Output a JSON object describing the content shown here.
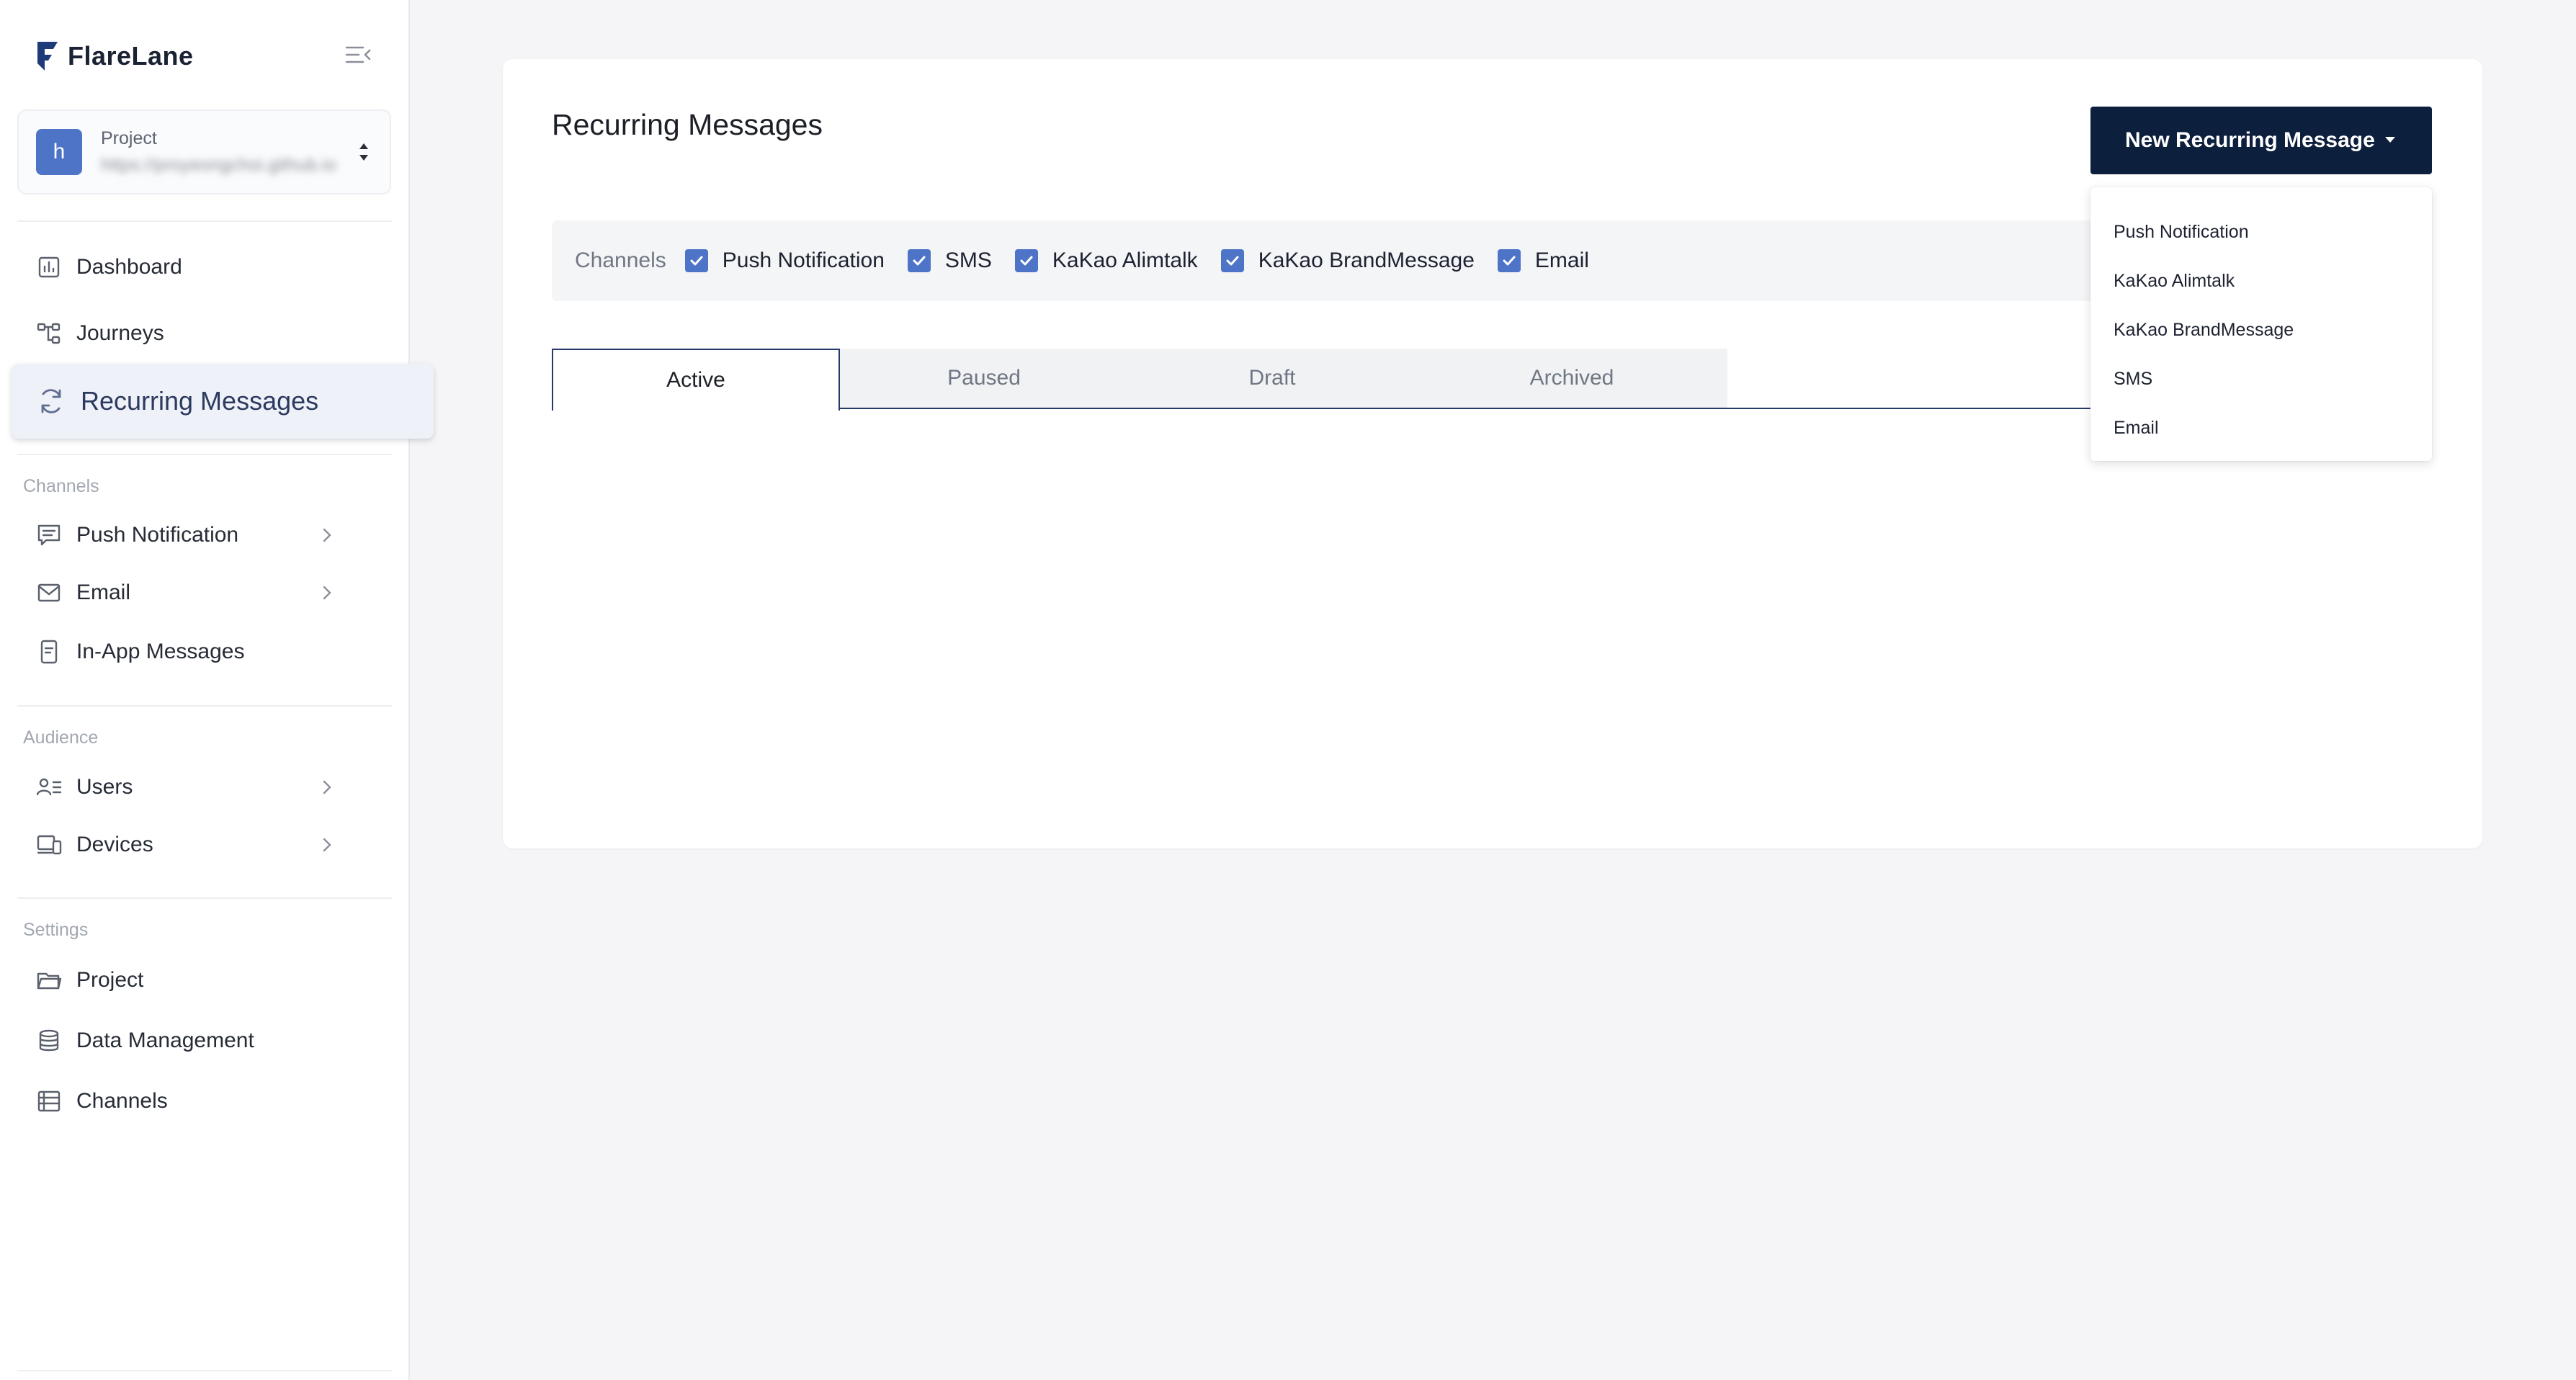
{
  "brand": {
    "name": "FlareLane"
  },
  "project": {
    "avatar_letter": "h",
    "label": "Project",
    "url": "https://proyeongchoi.github.io"
  },
  "nav": {
    "dashboard": "Dashboard",
    "journeys": "Journeys",
    "recurring": "Recurring Messages"
  },
  "sections": {
    "channels": {
      "title": "Channels",
      "push": "Push Notification",
      "email": "Email",
      "inapp": "In-App Messages"
    },
    "audience": {
      "title": "Audience",
      "users": "Users",
      "devices": "Devices"
    },
    "settings": {
      "title": "Settings",
      "project": "Project",
      "data": "Data Management",
      "channels": "Channels"
    }
  },
  "main": {
    "title": "Recurring Messages",
    "new_button": "New Recurring Message",
    "dropdown": [
      "Push Notification",
      "KaKao Alimtalk",
      "KaKao BrandMessage",
      "SMS",
      "Email"
    ],
    "filter": {
      "title": "Channels",
      "options": [
        "Push Notification",
        "SMS",
        "KaKao Alimtalk",
        "KaKao BrandMessage",
        "Email"
      ]
    },
    "tabs": [
      "Active",
      "Paused",
      "Draft",
      "Archived"
    ]
  },
  "colors": {
    "accent": "#4e74c8",
    "primary_button": "#0c1f3c",
    "active_tab_border": "#243a6b"
  }
}
